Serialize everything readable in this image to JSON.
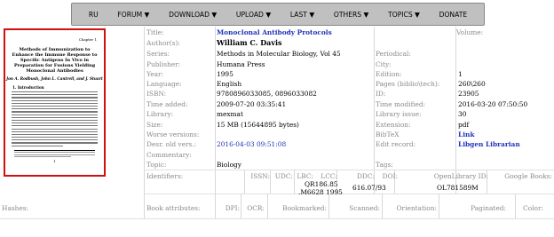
{
  "menu": [
    "RU",
    "FORUM ▼",
    "DOWNLOAD ▼",
    "UPLOAD ▼",
    "LAST ▼",
    "OTHERS ▼",
    "TOPICS ▼",
    "DONATE"
  ],
  "cover": {
    "chapter": "Chapter 1",
    "title": "Methods of Immunization to Enhance the Immune Response to Specific Antigens In Vivo in Preparation for Fusions Yielding Monoclonal Antibodies",
    "authors": "Jon A. Rodbush, John L. Cantrell, and J. Stuart",
    "section": "1. Introduction",
    "page": "1"
  },
  "left": [
    {
      "label": "Title:",
      "value": "Monoclonal Antibody Protocols"
    },
    {
      "label": "Author(s):",
      "value": "William C. Davis"
    },
    {
      "label": "Series:",
      "value": "Methods in Molecular Biology, Vol 45"
    },
    {
      "label": "Publisher:",
      "value": "Humana Press"
    },
    {
      "label": "Year:",
      "value": "1995"
    },
    {
      "label": "Language:",
      "value": "English"
    },
    {
      "label": "ISBN:",
      "value": "9780896033085, 0896033082"
    },
    {
      "label": "Time added:",
      "value": "2009-07-20 03:35:41"
    },
    {
      "label": "Library:",
      "value": "mexmat"
    },
    {
      "label": "Size:",
      "value": "15 MB (15644895 bytes)"
    },
    {
      "label": "Worse versions:",
      "value": ""
    },
    {
      "label": "Desr. old vers.:",
      "value": "2016-04-03 09:51:08"
    },
    {
      "label": "Commentary:",
      "value": ""
    },
    {
      "label": "Topic:",
      "value": "Biology"
    }
  ],
  "right": [
    {
      "label": "Volume:",
      "value": ""
    },
    {
      "label": "",
      "value": ""
    },
    {
      "label": "Periodical:",
      "value": ""
    },
    {
      "label": "City:",
      "value": ""
    },
    {
      "label": "Edition:",
      "value": "1"
    },
    {
      "label": "Pages (biblio\\tech):",
      "value": "260\\260"
    },
    {
      "label": "ID:",
      "value": "23905"
    },
    {
      "label": "Time modified:",
      "value": "2016-03-20 07:50:50"
    },
    {
      "label": "Library issue:",
      "value": "30"
    },
    {
      "label": "Extension:",
      "value": "pdf"
    },
    {
      "label": "BibTeX",
      "value": "Link"
    },
    {
      "label": "Edit record:",
      "value": "Libgen Librarian"
    },
    {
      "label": "",
      "value": ""
    },
    {
      "label": "Tags:",
      "value": ""
    }
  ],
  "identifiers": {
    "label": "Identifiers:",
    "issn": "ISSN:",
    "udc": "UDC:",
    "lbc": "LBC:",
    "lcc": "LCC:",
    "lcc_v1": "QR186.85",
    "lcc_v2": ".M6628 1995",
    "ddc": "DDC:",
    "ddc_v": "616.07/93",
    "doi": "DOI:",
    "ol": "OpenLibrary ID:",
    "ol_v": "OL781589M",
    "gb": "Google Books:"
  },
  "hashes": {
    "label": "Hashes:",
    "book_attr": "Book attributes:",
    "dpi": "DPI:",
    "ocr": "OCR:",
    "bookmarked": "Bookmarked:",
    "scanned": "Scanned:",
    "orientation": "Orientation:",
    "paginated": "Paginated:",
    "color": "Color:"
  }
}
